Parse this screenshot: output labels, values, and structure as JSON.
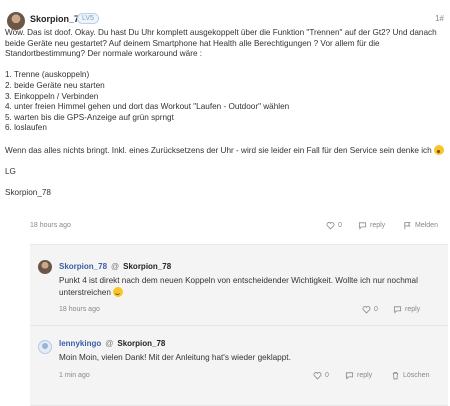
{
  "post": {
    "username": "Skorpion_78",
    "badge": "LV5",
    "post_number": "1#",
    "paragraph1": "Wow. Das ist doof. Okay. Du hast Du Uhr komplett ausgekoppelt über die Funktion \"Trennen\" auf der Gt2? Und danach beide Geräte neu gestartet? Auf deinem Smartphone hat Health alle Berechtigungen ? Vor allem für die Standortbestimmung? Der normale workaround wäre :",
    "steps": [
      "1. Trenne (auskoppeln)",
      "2. beide Geräte neu starten",
      "3. Einkoppeln / Verbinden",
      "4. unter freien Himmel gehen und dort das Workout \"Laufen - Outdoor\" wählen",
      "5. warten bis die GPS-Anzeige auf grün sprngt",
      "6. loslaufen"
    ],
    "paragraph2": "Wenn das alles nichts bringt. Inkl. eines Zurücksetzens der Uhr - wird sie leider ein Fall für den Service sein denke ich",
    "closing": "LG",
    "signature": "Skorpion_78",
    "time": "18 hours ago",
    "likes": "0",
    "reply_label": "reply",
    "report_label": "Melden"
  },
  "replies": [
    {
      "username": "Skorpion_78",
      "reply_to": "Skorpion_78",
      "text": "Punkt 4 ist direkt nach dem neuen Koppeln von entscheidender Wichtigkeit. Wollte ich nur nochmal unterstreichen",
      "time": "18 hours ago",
      "likes": "0",
      "reply_label": "reply"
    },
    {
      "username": "lennykingo",
      "reply_to": "Skorpion_78",
      "text": "Moin Moin, vielen Dank! Mit der Anleitung hat's wieder geklappt.",
      "time": "1 min ago",
      "likes": "0",
      "reply_label": "reply",
      "delete_label": "Löschen"
    }
  ],
  "at_symbol": "@",
  "colors": {
    "link_blue": "#3a5ea6",
    "muted": "#888888",
    "panel_bg": "#f4f4f4"
  },
  "icons": [
    "like-icon",
    "reply-icon",
    "flag-icon",
    "trash-icon",
    "emoji-shocked",
    "emoji-smile"
  ]
}
